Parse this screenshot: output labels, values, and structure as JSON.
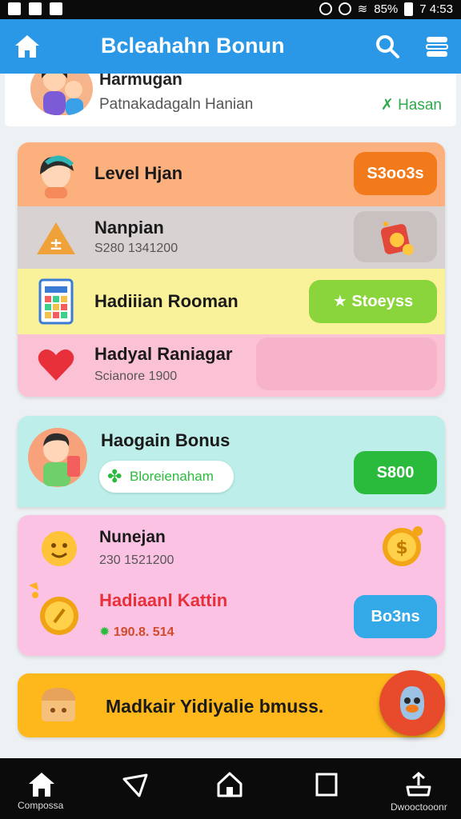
{
  "status": {
    "battery": "85%",
    "time": "7 4:53"
  },
  "app": {
    "title": "Bcleahahn Bonun"
  },
  "profile": {
    "name": "Harmugan",
    "subtitle": "Patnakadagaln Hanian",
    "link": "Hasan"
  },
  "card1": {
    "rows": [
      {
        "title": "Level Hjan",
        "button": "S3oo3s"
      },
      {
        "title": "Nanpian",
        "subtitle": "S280 1341200"
      },
      {
        "title": "Hadiiian Rooman",
        "button": "Stoeyss"
      },
      {
        "title": "Hadyal Raniagar",
        "subtitle": "Scianore 1900"
      }
    ]
  },
  "card2": {
    "title": "Haogain Bonus",
    "tag": "Bloreienaham",
    "button": "S800"
  },
  "card3": {
    "row1": {
      "title": "Nunejan",
      "subtitle": "230 1521200"
    },
    "row2": {
      "title": "Hadiaanl Kattin",
      "amount": "190.8. 514",
      "button": "Bo3ns"
    }
  },
  "card4": {
    "text": "Madkair Yidiyalie bmuss."
  },
  "nav": {
    "left_label": "Compossa",
    "right_label": "Dwooctooonr"
  },
  "colors": {
    "appbar": "#2a98e6",
    "orange": "#f27a1a",
    "green": "#8ad43c",
    "green_dark": "#2bbb3c",
    "blue_pill": "#34a9e8",
    "peach": "#fbb07e",
    "gray": "#d9d2d2",
    "yellow": "#f9f29a",
    "pink": "#fbc2d6",
    "teal": "#bdeee9",
    "gold": "#ffb81c",
    "fab": "#e84a2c"
  }
}
